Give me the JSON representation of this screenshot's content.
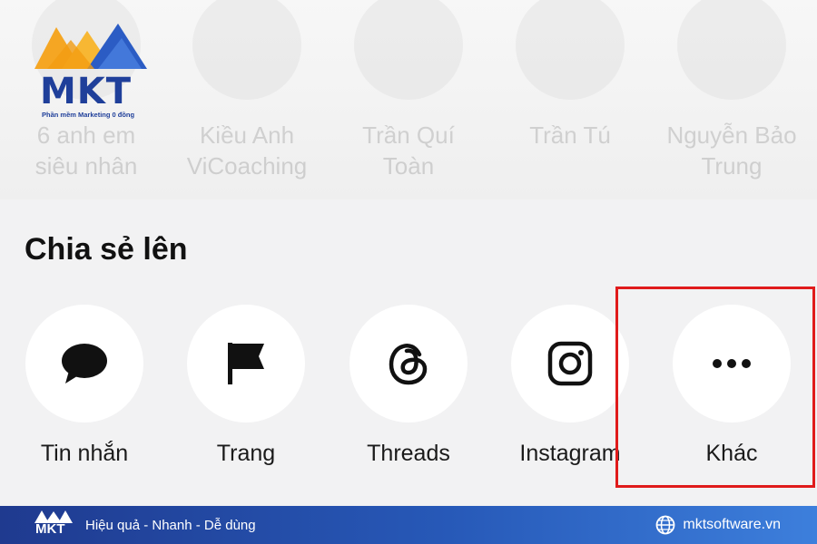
{
  "logo": {
    "text": "MKT",
    "tagline": "Phần mềm Marketing 0 đồng"
  },
  "contacts": [
    {
      "name": "6 anh em\nsiêu nhân"
    },
    {
      "name": "Kiều Anh\nViCoaching"
    },
    {
      "name": "Trần Quí\nToàn"
    },
    {
      "name": "Trần Tú"
    },
    {
      "name": "Nguyễn Bảo\nTrung"
    }
  ],
  "share": {
    "title": "Chia sẻ lên",
    "options": [
      {
        "label": "Tin nhắn",
        "icon": "message-bubble-icon"
      },
      {
        "label": "Trang",
        "icon": "flag-icon"
      },
      {
        "label": "Threads",
        "icon": "threads-icon"
      },
      {
        "label": "Instagram",
        "icon": "instagram-icon"
      },
      {
        "label": "Khác",
        "icon": "more-dots-icon"
      }
    ],
    "highlighted": "Khác",
    "highlight_color": "#e01b1b"
  },
  "footer": {
    "logo_text": "MKT",
    "tagline": "Hiệu quả - Nhanh - Dễ dùng",
    "website": "mktsoftware.vn",
    "gradient": [
      "#1f3a8f",
      "#3d7fdc"
    ]
  }
}
